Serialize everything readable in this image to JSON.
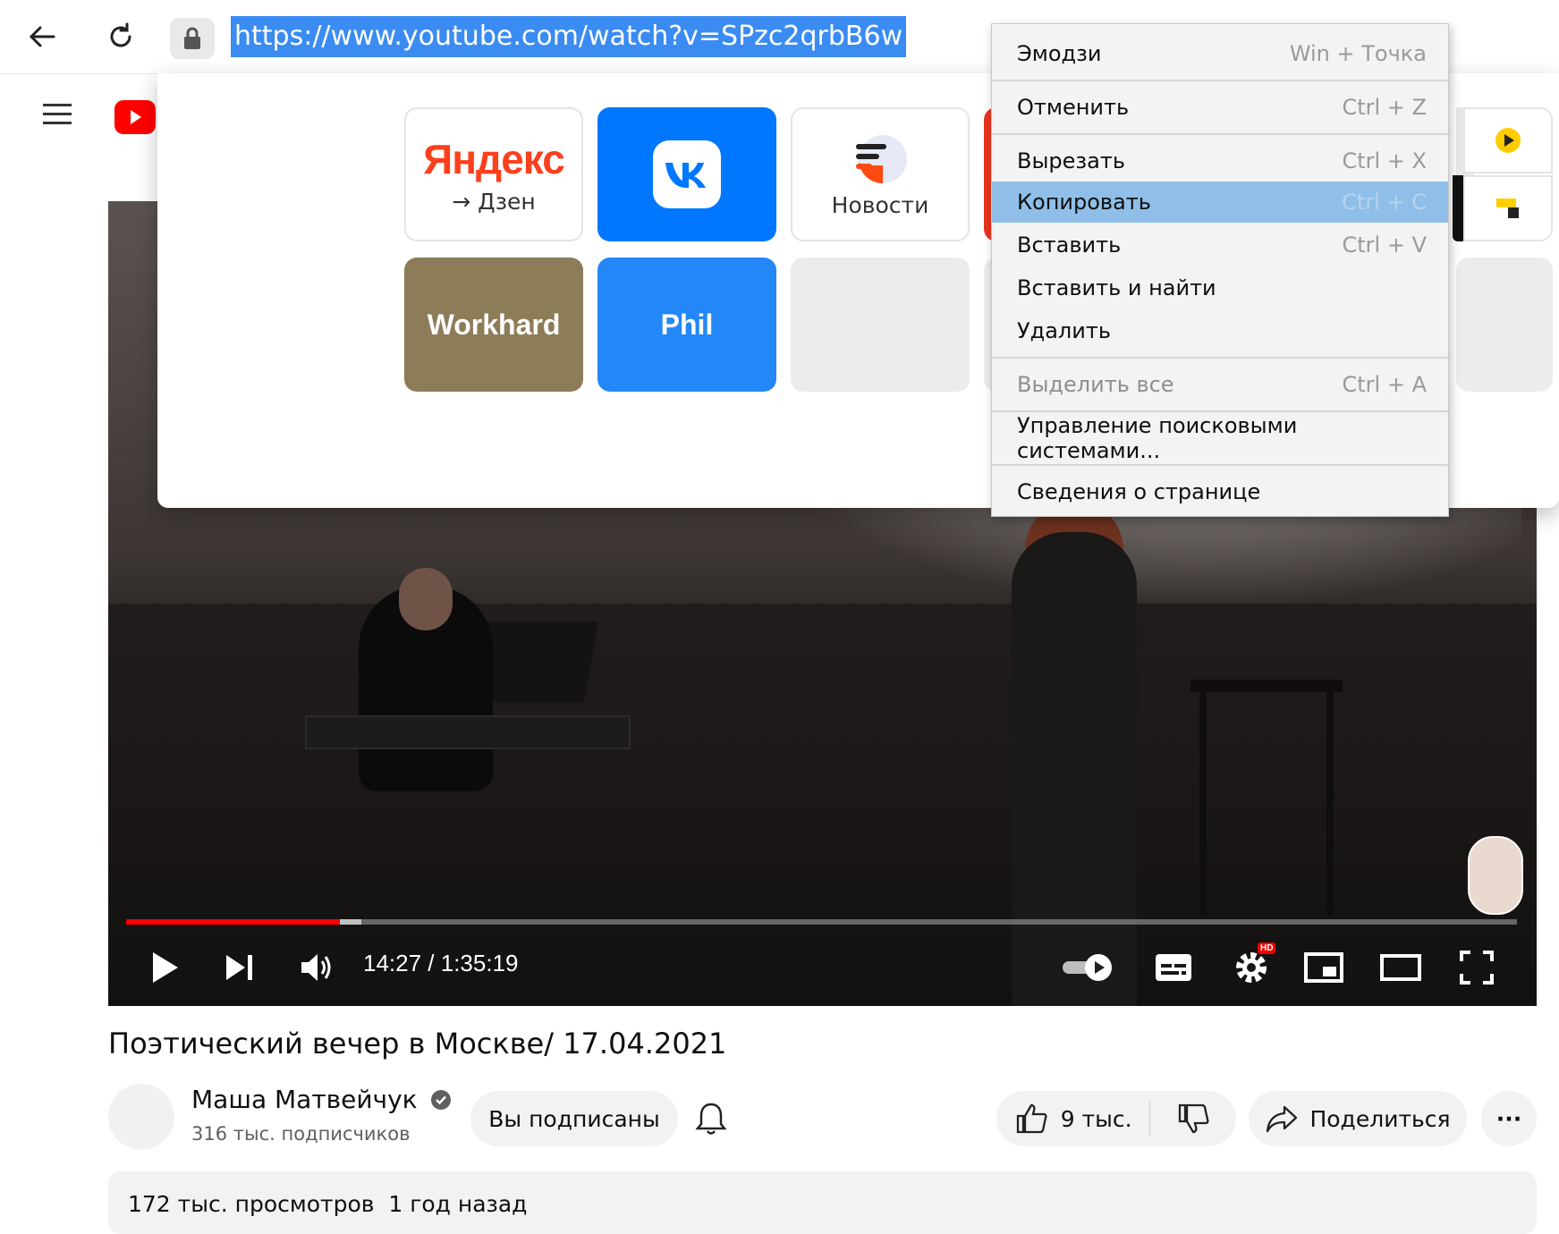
{
  "browser": {
    "url": "https://www.youtube.com/watch?v=SPzc2qrbB6w",
    "back_icon": "arrow-left-icon",
    "reload_icon": "reload-icon",
    "lock_icon": "lock-icon"
  },
  "speed_dial": {
    "tiles": [
      {
        "id": "yandex",
        "brand": "Яндекс",
        "label": "→ Дзен"
      },
      {
        "id": "vk",
        "label": ""
      },
      {
        "id": "news",
        "label": "Новости"
      },
      {
        "id": "workhard",
        "label": "Workhard",
        "color": "#8c7c58"
      },
      {
        "id": "phil",
        "label": "Phil",
        "color": "#2387f7"
      },
      {
        "id": "empty",
        "label": ""
      }
    ]
  },
  "context_menu": {
    "items": [
      {
        "label": "Эмодзи",
        "shortcut": "Win + Точка",
        "state": "normal"
      },
      {
        "label": "Отменить",
        "shortcut": "Ctrl + Z",
        "state": "normal"
      },
      {
        "label": "Вырезать",
        "shortcut": "Ctrl + X",
        "state": "normal"
      },
      {
        "label": "Копировать",
        "shortcut": "Ctrl + C",
        "state": "highlighted"
      },
      {
        "label": "Вставить",
        "shortcut": "Ctrl + V",
        "state": "normal"
      },
      {
        "label": "Вставить и найти",
        "shortcut": "",
        "state": "normal"
      },
      {
        "label": "Удалить",
        "shortcut": "",
        "state": "normal"
      },
      {
        "label": "Выделить все",
        "shortcut": "Ctrl + A",
        "state": "disabled"
      },
      {
        "label": "Управление поисковыми системами...",
        "shortcut": "",
        "state": "normal"
      },
      {
        "label": "Сведения о странице",
        "shortcut": "",
        "state": "normal"
      }
    ]
  },
  "player": {
    "time": "14:27 / 1:35:19",
    "played_fraction": 0.154,
    "buffered_fraction": 0.169,
    "hd_badge": "HD"
  },
  "video": {
    "title": "Поэтический вечер в Москве/ 17.04.2021",
    "channel_name": "Маша Матвейчук",
    "subscribers": "316 тыс. подписчиков",
    "subscribe_label": "Вы подписаны",
    "likes": "9 тыс.",
    "share_label": "Поделиться",
    "more_label": "···",
    "views_date": "172 тыс. просмотров  1 год назад"
  },
  "colors": {
    "url_highlight": "#3a8cf2",
    "menu_highlight": "#8fbfe8",
    "youtube_red": "#ff0000",
    "vk_blue": "#0077ff"
  }
}
